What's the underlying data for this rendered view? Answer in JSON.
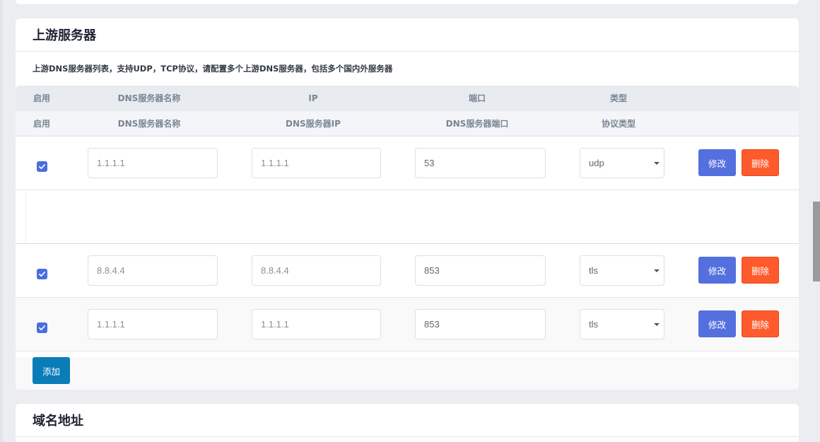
{
  "upstream": {
    "title": "上游服务器",
    "description": "上游DNS服务器列表，支持UDP，TCP协议，请配置多个上游DNS服务器，包括多个国内外服务器",
    "header_row_1": [
      "启用",
      "DNS服务器名称",
      "IP",
      "端口",
      "类型"
    ],
    "header_row_2": [
      "启用",
      "DNS服务器名称",
      "DNS服务器IP",
      "DNS服务器端口",
      "协议类型"
    ],
    "rows": [
      {
        "enabled": true,
        "name": "1.1.1.1",
        "ip": "1.1.1.1",
        "port": "53",
        "type": "udp"
      },
      {
        "enabled": true,
        "name": "8.8.4.4",
        "ip": "8.8.4.4",
        "port": "853",
        "type": "tls"
      },
      {
        "enabled": true,
        "name": "1.1.1.1",
        "ip": "1.1.1.1",
        "port": "853",
        "type": "tls"
      }
    ],
    "edit_label": "修改",
    "delete_label": "删除",
    "add_label": "添加"
  },
  "domain": {
    "title": "域名地址"
  },
  "colors": {
    "edit_button": "#5470de",
    "delete_button": "#fe5a2b",
    "add_button": "#0a7db8",
    "checkbox": "#4a6ee0"
  },
  "icons": {
    "checkbox": "check-icon",
    "select": "caret-down-icon"
  }
}
